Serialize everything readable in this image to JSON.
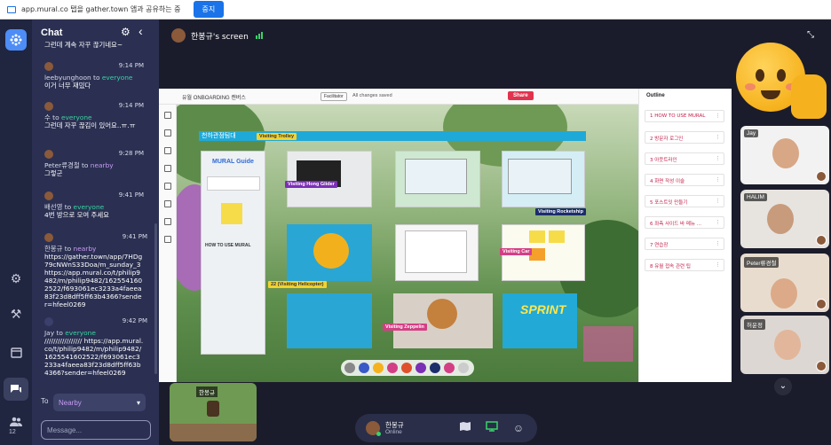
{
  "share_bar": {
    "text": "app.mural.co 탭을 gather.town 앱과 공유하는 중",
    "stop_label": "중지"
  },
  "sidebar": {
    "participant_count": "12"
  },
  "chat": {
    "title": "Chat",
    "messages": [
      {
        "text": "그런데 계속 자꾸 끊기네요~"
      },
      {
        "sender": "leebyunghoon",
        "to_word": "to",
        "target": "everyone",
        "time": "9:14 PM",
        "text": "이거 너무 재밌다"
      },
      {
        "sender": "수",
        "to_word": "to",
        "target": "everyone",
        "time": "9:14 PM",
        "text": "그런데 자꾸 끊김이 있어요..ㅠ.ㅠ"
      },
      {
        "sender": "Peter류경철",
        "to_word": "to",
        "target": "nearby",
        "time": "9:28 PM",
        "text": "그렇군"
      },
      {
        "sender": "배선영",
        "to_word": "to",
        "target": "everyone",
        "time": "9:41 PM",
        "text": "4번 방으로 모여 주세요"
      },
      {
        "sender": "한봉규",
        "to_word": "to",
        "target": "nearby",
        "time": "9:41 PM",
        "text": "https://gather.town/app/7HDg79cNWnS33Doa/m_sunday_3 https://app.mural.co/t/philip9482/m/philip9482/1625541602522/f693061ec3233a4faeea83f23d8dff5ff63b4366?sender=hfeel0269"
      },
      {
        "sender": "Jay",
        "to_word": "to",
        "target": "everyone",
        "time": "9:42 PM",
        "text": "///////////////// https://app.mural.co/t/philip9482/m/philip9482/1625541602522/f693061ec3233a4faeea83f23d8dff5ff63b4366?sender=hfeel0269"
      }
    ],
    "to_label": "To",
    "to_value": "Nearby",
    "input_placeholder": "Message..."
  },
  "screen": {
    "title": "한봉규's screen"
  },
  "mural": {
    "board_title": "유월 ONBOARDING 캔버스",
    "facilitator": "Facilitator",
    "saved": "All changes saved",
    "share": "Share",
    "banner": "천하관점팀대",
    "guide_title": "MURAL Guide",
    "guide_subtitle": "HOW TO USE MURAL",
    "tags": {
      "trolley": "Visiting Trolley",
      "hong": "Visiting Hong Glider",
      "rocketship": "Visiting Rocketship",
      "car": "Visiting Car",
      "helicopter": "22 (Visiting Helicopter)",
      "zeppelin": "Visiting Zeppelin"
    },
    "sprint": "SPRINT",
    "outline_title": "Outline",
    "outline_items": [
      "1 HOW TO USE MURAL",
      "2 방문자 로그인",
      "3 아웃트라인",
      "4 화면 작성 이슬",
      "5 포스트잇 만들기",
      "6 좌측 사이드 바 메뉴 ...",
      "7 연습장",
      "8 유월 접속 관련 팁"
    ]
  },
  "videos": [
    {
      "name": "Jay"
    },
    {
      "name": "HALIM"
    },
    {
      "name": "Peter류경철"
    },
    {
      "name": "허운정"
    }
  ],
  "minimap": {
    "label": "한봉규"
  },
  "bottom_bar": {
    "name": "한봉규",
    "status": "Online"
  },
  "colors": {
    "chat_bg": "#2b3052",
    "everyone": "#39d3a2",
    "nearby": "#c89af5",
    "accent": "#1a73e8"
  }
}
